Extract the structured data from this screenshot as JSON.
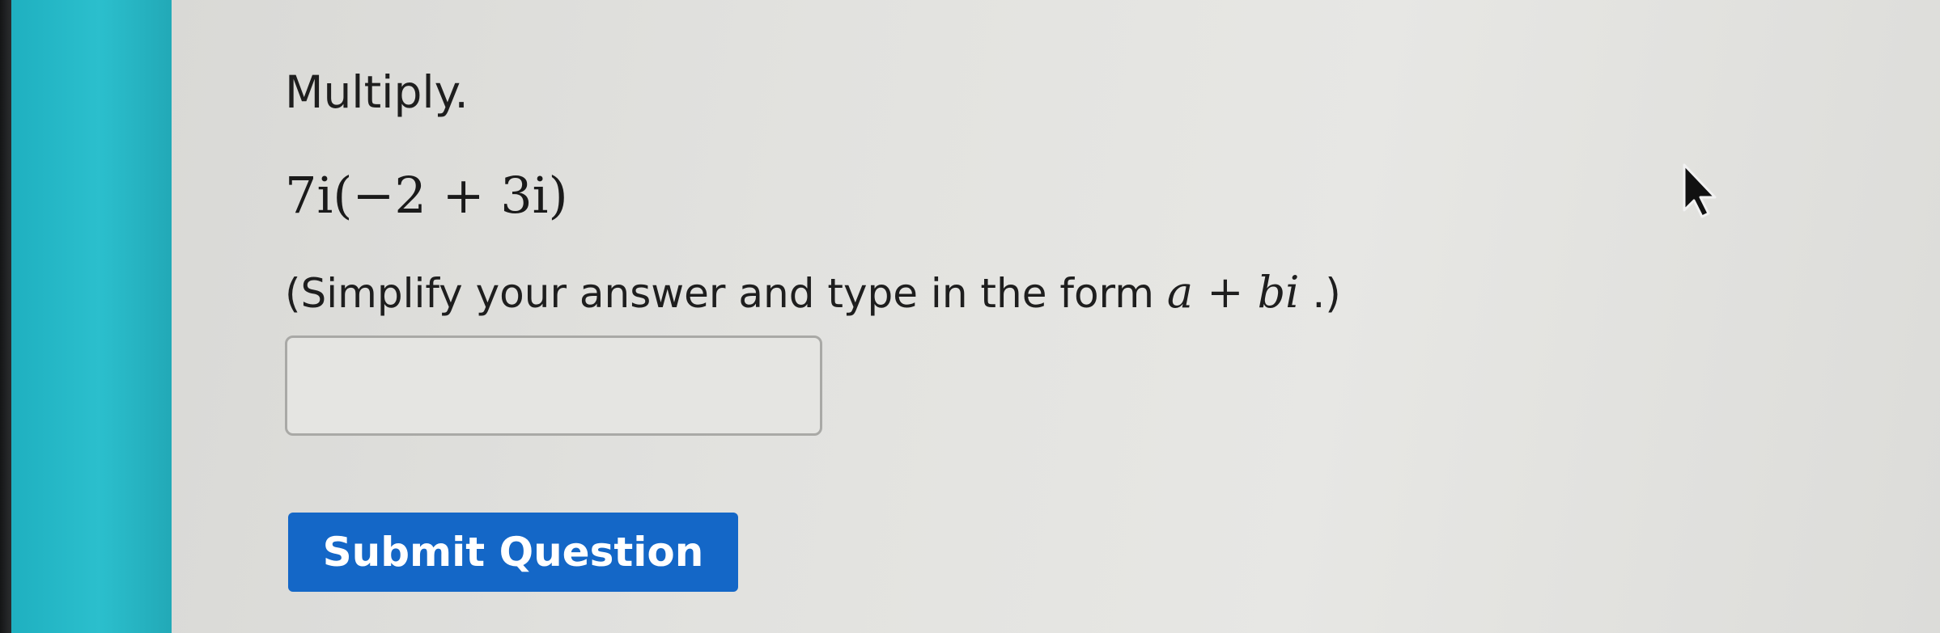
{
  "question": {
    "instruction": "Multiply.",
    "expression": "7i(−2 + 3i)",
    "hint_prefix": "(Simplify your answer and type in the form ",
    "hint_math": "a + bi",
    "hint_suffix": " .)"
  },
  "answer": {
    "value": ""
  },
  "submit": {
    "label": "Submit Question"
  },
  "colors": {
    "side_strip": "#2bbfcd",
    "button": "#1467c7"
  },
  "icons": {
    "cursor": "mouse-pointer-icon"
  }
}
